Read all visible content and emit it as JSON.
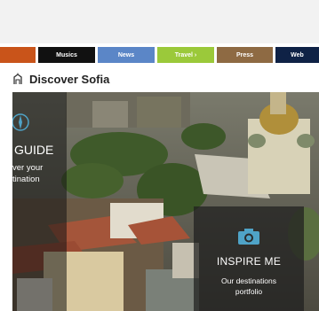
{
  "nav": {
    "tabs": [
      {
        "label": "",
        "color": "#c9541a"
      },
      {
        "label": "Musics",
        "color": "#111111"
      },
      {
        "label": "News",
        "color": "#5b86c7"
      },
      {
        "label": "Travel ›",
        "color": "#9bc93a"
      },
      {
        "label": "Press",
        "color": "#8e6a43"
      },
      {
        "label": "Web",
        "color": "#0f2246"
      }
    ]
  },
  "page": {
    "title": "Discover Sofia",
    "title_icon": "building-icon"
  },
  "hero": {
    "guide": {
      "icon": "compass-icon",
      "title": "GUIDE",
      "line1": "ver your",
      "line2": "tination"
    },
    "inspire": {
      "icon": "camera-icon",
      "title": "INSPIRE ME",
      "line1": "Our destinations",
      "line2": "portfolio"
    }
  }
}
